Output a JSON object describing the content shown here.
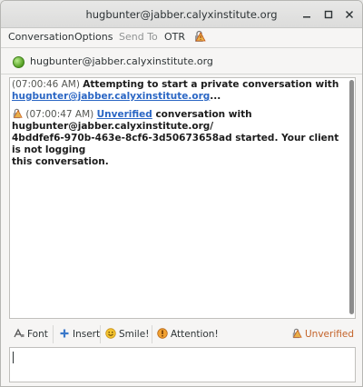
{
  "window": {
    "title": "hugbunter@jabber.calyxinstitute.org"
  },
  "menu": {
    "conversation": "Conversation",
    "options": "Options",
    "send_to": "Send To",
    "otr": "OTR"
  },
  "buddy": {
    "name": "hugbunter@jabber.calyxinstitute.org",
    "status": "available"
  },
  "messages": [
    {
      "time": "(07:00:46 AM)",
      "text": "Attempting to start a private conversation with",
      "link": "hugbunter@jabber.calyxinstitute.org",
      "suffix": "..."
    },
    {
      "time": "(07:00:47 AM)",
      "link": "Unverified",
      "text1": " conversation with",
      "line2": "hugbunter@jabber.calyxinstitute.org/",
      "line3": "4bddfef6-970b-463e-8cf6-3d50673658ad started.  Your client is not logging",
      "line4": "this conversation."
    }
  ],
  "toolbar": {
    "font": "Font",
    "insert": "Insert",
    "smile": "Smile!",
    "attention": "Attention!",
    "otr_status": "Unverified"
  },
  "colors": {
    "accent_link": "#2a66c4",
    "unverified": "#c4632a",
    "status_online": "#5aa428"
  }
}
